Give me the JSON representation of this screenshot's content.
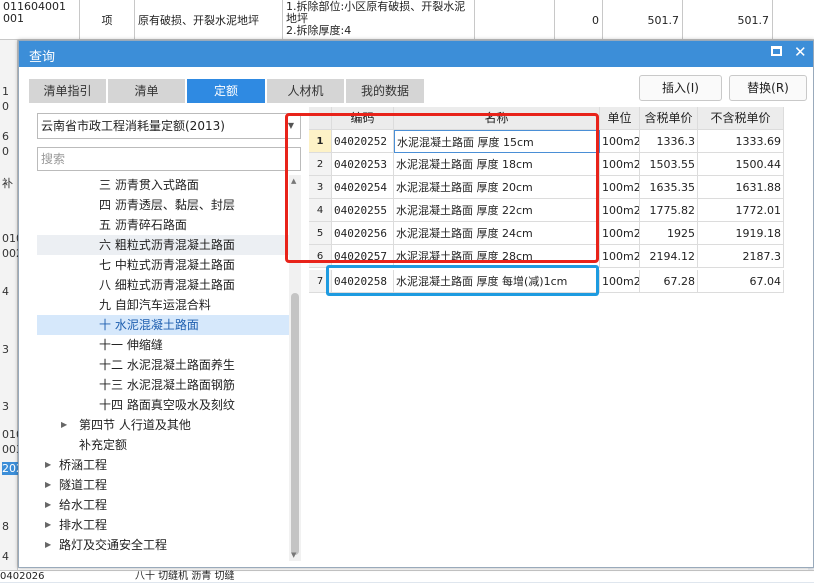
{
  "background": {
    "top_code": "011604001\n001",
    "top_unit": "项",
    "top_desc1": "原有破损、开裂水泥地坪",
    "top_desc2": "1.拆除部位:小区原有破损、开裂水泥地坪\n2.拆除厚度:4",
    "top_num1": "0",
    "top_num2": "501.7",
    "top_num3": "501.7",
    "left_marks": [
      "1",
      "0",
      "6",
      "0",
      "补",
      "010",
      "002",
      "4",
      "3",
      "3",
      "010",
      "003",
      "202",
      "8",
      "4"
    ],
    "bottom_code": "0402026",
    "bottom_text": "八十 切缝机 沥青 切缝"
  },
  "dialog": {
    "title": "查询",
    "tabs": [
      "清单指引",
      "清单",
      "定额",
      "人材机",
      "我的数据"
    ],
    "active_tab": "定额",
    "insert_btn": "插入(I)",
    "replace_btn": "替换(R)"
  },
  "left": {
    "quota_select": "云南省市政工程消耗量定额(2013)",
    "search_placeholder": "搜索",
    "tree": [
      {
        "label": "三 沥青贯入式路面",
        "indent": 2
      },
      {
        "label": "四 沥青透层、黏层、封层",
        "indent": 2
      },
      {
        "label": "五 沥青碎石路面",
        "indent": 2
      },
      {
        "label": "六 粗粒式沥青混凝土路面",
        "indent": 2,
        "state": "hl"
      },
      {
        "label": "七 中粒式沥青混凝土路面",
        "indent": 2
      },
      {
        "label": "八 细粒式沥青混凝土路面",
        "indent": 2
      },
      {
        "label": "九 自卸汽车运混合料",
        "indent": 2
      },
      {
        "label": "十 水泥混凝土路面",
        "indent": 2,
        "state": "sel"
      },
      {
        "label": "十一 伸缩缝",
        "indent": 2
      },
      {
        "label": "十二 水泥混凝土路面养生",
        "indent": 2
      },
      {
        "label": "十三 水泥混凝土路面钢筋",
        "indent": 2
      },
      {
        "label": "十四 路面真空吸水及刻纹",
        "indent": 2
      },
      {
        "label": "第四节 人行道及其他",
        "indent": 1,
        "caret": true
      },
      {
        "label": "补充定额",
        "indent": 1
      },
      {
        "label": "桥涵工程",
        "indent": 0,
        "caret": true
      },
      {
        "label": "隧道工程",
        "indent": 0,
        "caret": true
      },
      {
        "label": "给水工程",
        "indent": 0,
        "caret": true
      },
      {
        "label": "排水工程",
        "indent": 0,
        "caret": true
      },
      {
        "label": "路灯及交通安全工程",
        "indent": 0,
        "caret": true
      }
    ]
  },
  "table": {
    "headers": [
      "编码",
      "名称",
      "单位",
      "含税单价",
      "不含税单价"
    ],
    "rows": [
      {
        "n": "1",
        "code": "04020252",
        "name": "水泥混凝土路面 厚度 15cm",
        "unit": "100m2",
        "tax": "1336.3",
        "notax": "1333.69"
      },
      {
        "n": "2",
        "code": "04020253",
        "name": "水泥混凝土路面 厚度 18cm",
        "unit": "100m2",
        "tax": "1503.55",
        "notax": "1500.44"
      },
      {
        "n": "3",
        "code": "04020254",
        "name": "水泥混凝土路面 厚度 20cm",
        "unit": "100m2",
        "tax": "1635.35",
        "notax": "1631.88"
      },
      {
        "n": "4",
        "code": "04020255",
        "name": "水泥混凝土路面 厚度 22cm",
        "unit": "100m2",
        "tax": "1775.82",
        "notax": "1772.01"
      },
      {
        "n": "5",
        "code": "04020256",
        "name": "水泥混凝土路面 厚度 24cm",
        "unit": "100m2",
        "tax": "1925",
        "notax": "1919.18"
      },
      {
        "n": "6",
        "code": "04020257",
        "name": "水泥混凝土路面 厚度 28cm",
        "unit": "100m2",
        "tax": "2194.12",
        "notax": "2187.3"
      },
      {
        "n": "7",
        "code": "04020258",
        "name": "水泥混凝土路面 厚度 每增(减)1cm",
        "unit": "100m2",
        "tax": "67.28",
        "notax": "67.04"
      }
    ]
  },
  "colors": {
    "accent": "#2f8ae2",
    "red_box": "#e8231a",
    "blue_box": "#1e9be0"
  }
}
